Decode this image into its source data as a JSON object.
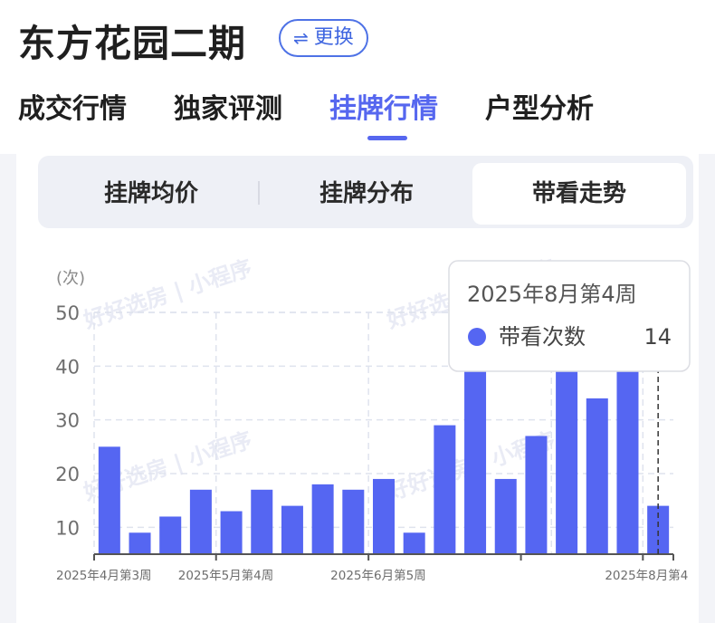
{
  "header": {
    "title": "东方花园二期",
    "switch_label": "更换",
    "switch_icon": "swap-arrows-icon"
  },
  "tabs": [
    {
      "label": "成交行情",
      "active": false
    },
    {
      "label": "独家评测",
      "active": false
    },
    {
      "label": "挂牌行情",
      "active": true
    },
    {
      "label": "户型分析",
      "active": false
    }
  ],
  "subtabs": [
    {
      "label": "挂牌均价",
      "active": false
    },
    {
      "label": "挂牌分布",
      "active": false
    },
    {
      "label": "带看走势",
      "active": true
    }
  ],
  "watermark": "好好选房 | 小程序",
  "colors": {
    "accent": "#5667ef",
    "bar": "#5566f2",
    "switch_border": "#4e72e6"
  },
  "chart_data": {
    "type": "bar",
    "ylabel": "(次)",
    "ylim": [
      5,
      50
    ],
    "yticks": [
      10,
      20,
      30,
      40,
      50
    ],
    "grid": true,
    "x_tick_labels": [
      {
        "index": 0,
        "label": "2025年4月第3周"
      },
      {
        "index": 4,
        "label": "2025年5月第4周"
      },
      {
        "index": 9,
        "label": "2025年6月第5周"
      },
      {
        "index": 18,
        "label": "2025年8月第4"
      }
    ],
    "categories": [
      "2025年4月第3周",
      "",
      "",
      "",
      "2025年5月第4周",
      "",
      "",
      "",
      "",
      "2025年6月第5周",
      "",
      "",
      "",
      "",
      "",
      "",
      "",
      "",
      "2025年8月第4周"
    ],
    "series": [
      {
        "name": "带看次数",
        "values": [
          25,
          9,
          12,
          17,
          13,
          17,
          14,
          18,
          17,
          19,
          9,
          29,
          43,
          19,
          27,
          45,
          34,
          42,
          14
        ]
      }
    ],
    "tooltip": {
      "index": 18,
      "title": "2025年8月第4周",
      "label": "带看次数",
      "value": "14"
    }
  }
}
